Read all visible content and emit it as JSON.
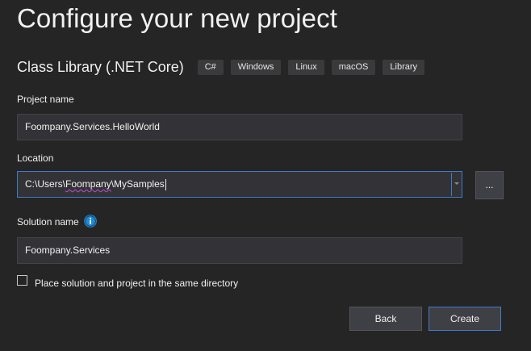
{
  "page": {
    "title": "Configure your new project"
  },
  "template": {
    "name": "Class Library (.NET Core)",
    "tags": [
      "C#",
      "Windows",
      "Linux",
      "macOS",
      "Library"
    ]
  },
  "project_name": {
    "label": "Project name",
    "value": "Foompany.Services.HelloWorld"
  },
  "location": {
    "label": "Location",
    "value_prefix": "C:\\Users\\",
    "value_misspelled": "Foompany",
    "value_suffix": "\\MySamples",
    "browse_label": "..."
  },
  "solution_name": {
    "label": "Solution name",
    "info_icon": "info-icon",
    "value": "Foompany.Services"
  },
  "same_directory": {
    "label": "Place solution and project in the same directory",
    "checked": false
  },
  "buttons": {
    "back": "Back",
    "create": "Create"
  },
  "colors": {
    "background": "#252526",
    "accent": "#3f7cc4",
    "info_icon": "#1e8ad6",
    "spellcheck": "#c04adb"
  }
}
